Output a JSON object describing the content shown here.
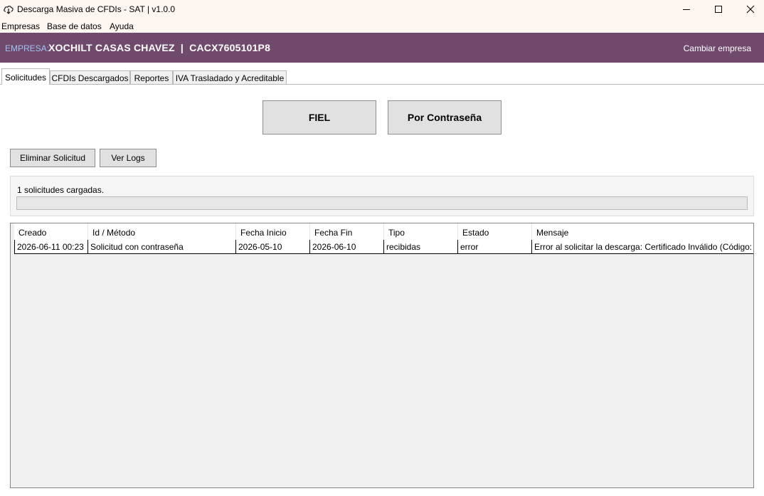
{
  "window": {
    "title": "Descarga Masiva de CFDIs - SAT | v1.0.0",
    "icon": "cloud-download-icon"
  },
  "menu": {
    "items": [
      {
        "label": "Empresas"
      },
      {
        "label": "Base de datos"
      },
      {
        "label": "Ayuda"
      }
    ]
  },
  "banner": {
    "label": "EMPRESA:",
    "company": "XOCHILT CASAS CHAVEZ  |  CACX7605101P8",
    "change_label": "Cambiar empresa",
    "color": "#704a6c"
  },
  "tabs": [
    {
      "label": "Solicitudes",
      "active": true
    },
    {
      "label": "CFDIs Descargados"
    },
    {
      "label": "Reportes"
    },
    {
      "label": "IVA Trasladado y Acreditable"
    }
  ],
  "actions": {
    "fiel_label": "FIEL",
    "password_label": "Por Contraseña",
    "delete_label": "Eliminar Solicitud",
    "logs_label": "Ver Logs"
  },
  "status": {
    "text": "1 solicitudes cargadas.",
    "progress": 0
  },
  "table": {
    "columns": [
      "Creado",
      "Id / Método",
      "Fecha Inicio",
      "Fecha Fin",
      "Tipo",
      "Estado",
      "Mensaje"
    ],
    "rows": [
      [
        "2026-06-11 00:23",
        "Solicitud con contraseña",
        "2026-05-10",
        "2026-06-10",
        "recibidas",
        "error",
        "Error al solicitar la descarga: Certificado Inválido (Código:"
      ]
    ]
  }
}
